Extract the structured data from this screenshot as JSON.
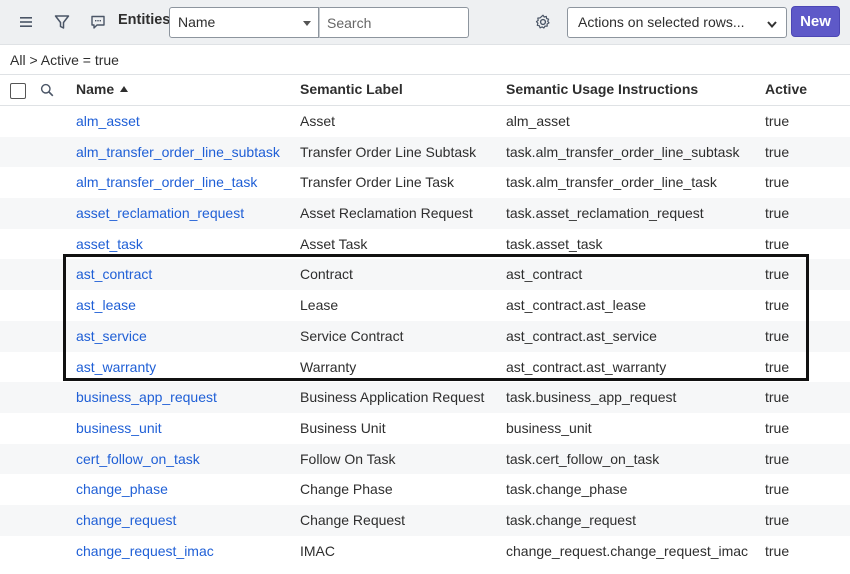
{
  "toolbar": {
    "title": "Entities",
    "field_selected": "Name",
    "search_placeholder": "Search",
    "actions_selected": "Actions on selected rows...",
    "new_label": "New"
  },
  "breadcrumb": "All > Active = true",
  "columns": {
    "name": "Name",
    "semantic_label": "Semantic Label",
    "usage": "Semantic Usage Instructions",
    "active": "Active"
  },
  "sort": {
    "column": "Name",
    "direction": "ascending"
  },
  "rows": [
    {
      "name": "alm_asset",
      "label": "Asset",
      "usage": "alm_asset",
      "active": "true"
    },
    {
      "name": "alm_transfer_order_line_subtask",
      "label": "Transfer Order Line Subtask",
      "usage": "task.alm_transfer_order_line_subtask",
      "active": "true"
    },
    {
      "name": "alm_transfer_order_line_task",
      "label": "Transfer Order Line Task",
      "usage": "task.alm_transfer_order_line_task",
      "active": "true"
    },
    {
      "name": "asset_reclamation_request",
      "label": "Asset Reclamation Request",
      "usage": "task.asset_reclamation_request",
      "active": "true"
    },
    {
      "name": "asset_task",
      "label": "Asset Task",
      "usage": "task.asset_task",
      "active": "true"
    },
    {
      "name": "ast_contract",
      "label": "Contract",
      "usage": "ast_contract",
      "active": "true"
    },
    {
      "name": "ast_lease",
      "label": "Lease",
      "usage": "ast_contract.ast_lease",
      "active": "true"
    },
    {
      "name": "ast_service",
      "label": "Service Contract",
      "usage": "ast_contract.ast_service",
      "active": "true"
    },
    {
      "name": "ast_warranty",
      "label": "Warranty",
      "usage": "ast_contract.ast_warranty",
      "active": "true"
    },
    {
      "name": "business_app_request",
      "label": "Business Application Request",
      "usage": "task.business_app_request",
      "active": "true"
    },
    {
      "name": "business_unit",
      "label": "Business Unit",
      "usage": "business_unit",
      "active": "true"
    },
    {
      "name": "cert_follow_on_task",
      "label": "Follow On Task",
      "usage": "task.cert_follow_on_task",
      "active": "true"
    },
    {
      "name": "change_phase",
      "label": "Change Phase",
      "usage": "task.change_phase",
      "active": "true"
    },
    {
      "name": "change_request",
      "label": "Change Request",
      "usage": "task.change_request",
      "active": "true"
    },
    {
      "name": "change_request_imac",
      "label": "IMAC",
      "usage": "change_request.change_request_imac",
      "active": "true"
    }
  ],
  "colors": {
    "link": "#1f5fd6",
    "primary_button": "#5e59c8",
    "toolbar_bg": "#eef0f2",
    "highlight_border": "#111111"
  },
  "icons": [
    "menu-icon",
    "filter-icon",
    "chat-icon",
    "gear-icon",
    "chevron-down-icon",
    "search-icon",
    "sort-ascending-icon"
  ]
}
